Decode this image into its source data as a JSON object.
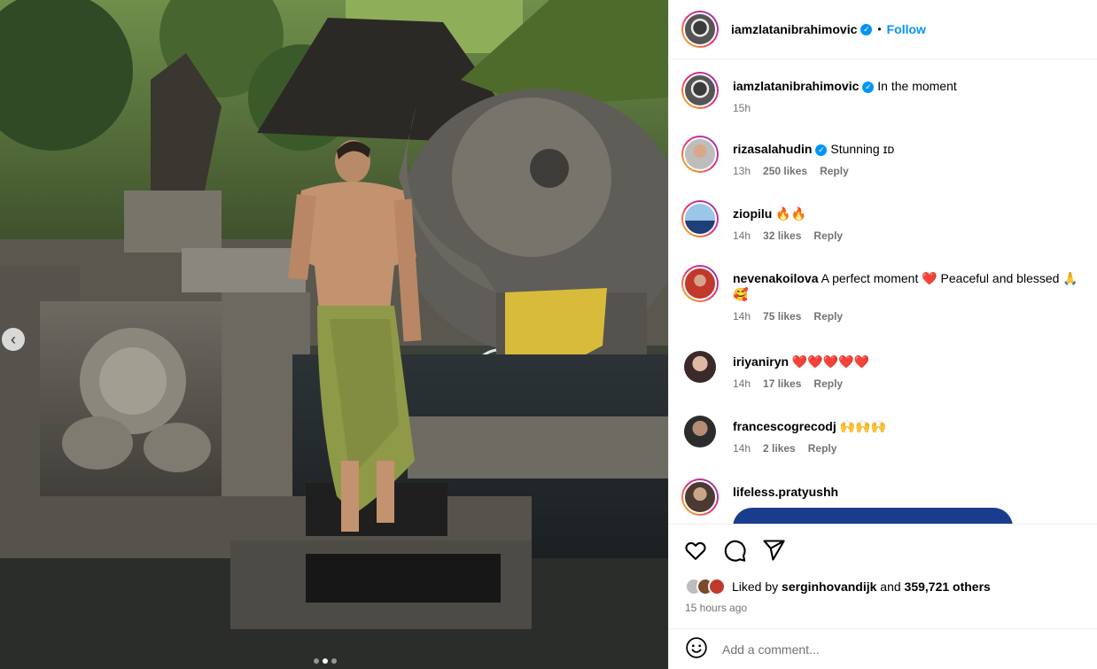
{
  "post": {
    "author": "iamzlatanibrahimovic",
    "follow_label": "Follow",
    "separator": "•",
    "caption": "In the moment",
    "caption_time": "15h"
  },
  "comments": [
    {
      "user": "rizasalahudin",
      "verified": true,
      "text": "Stunning ɪᴅ",
      "time": "13h",
      "likes": "250 likes",
      "reply": "Reply"
    },
    {
      "user": "ziopilu",
      "verified": false,
      "text": "🔥🔥",
      "time": "14h",
      "likes": "32 likes",
      "reply": "Reply"
    },
    {
      "user": "nevenakoilova",
      "verified": false,
      "text": "A perfect moment ❤️ Peaceful and blessed 🙏",
      "text2": "🥰",
      "time": "14h",
      "likes": "75 likes",
      "reply": "Reply"
    },
    {
      "user": "iriyaniryn",
      "verified": false,
      "text": "❤️❤️❤️❤️❤️",
      "time": "14h",
      "likes": "17 likes",
      "reply": "Reply"
    },
    {
      "user": "francescogrecodj",
      "verified": false,
      "text": "🙌🙌🙌",
      "time": "14h",
      "likes": "2 likes",
      "reply": "Reply"
    },
    {
      "user": "lifeless.pratyushh",
      "verified": false,
      "text": ""
    }
  ],
  "likes": {
    "prefix": "Liked by",
    "user": "serginhovandijk",
    "and": "and",
    "others": "359,721 others"
  },
  "timestamp": "15 hours ago",
  "add_comment_placeholder": "Add a comment...",
  "icons": {
    "like": "heart-outline-icon",
    "comment": "speech-bubble-icon",
    "share": "paper-plane-icon",
    "emoji": "smiley-icon",
    "verified": "verified-badge-icon",
    "carousel_prev": "chevron-left-icon"
  },
  "colors": {
    "accent": "#0095f6",
    "muted": "#737373",
    "border": "#efefef"
  }
}
